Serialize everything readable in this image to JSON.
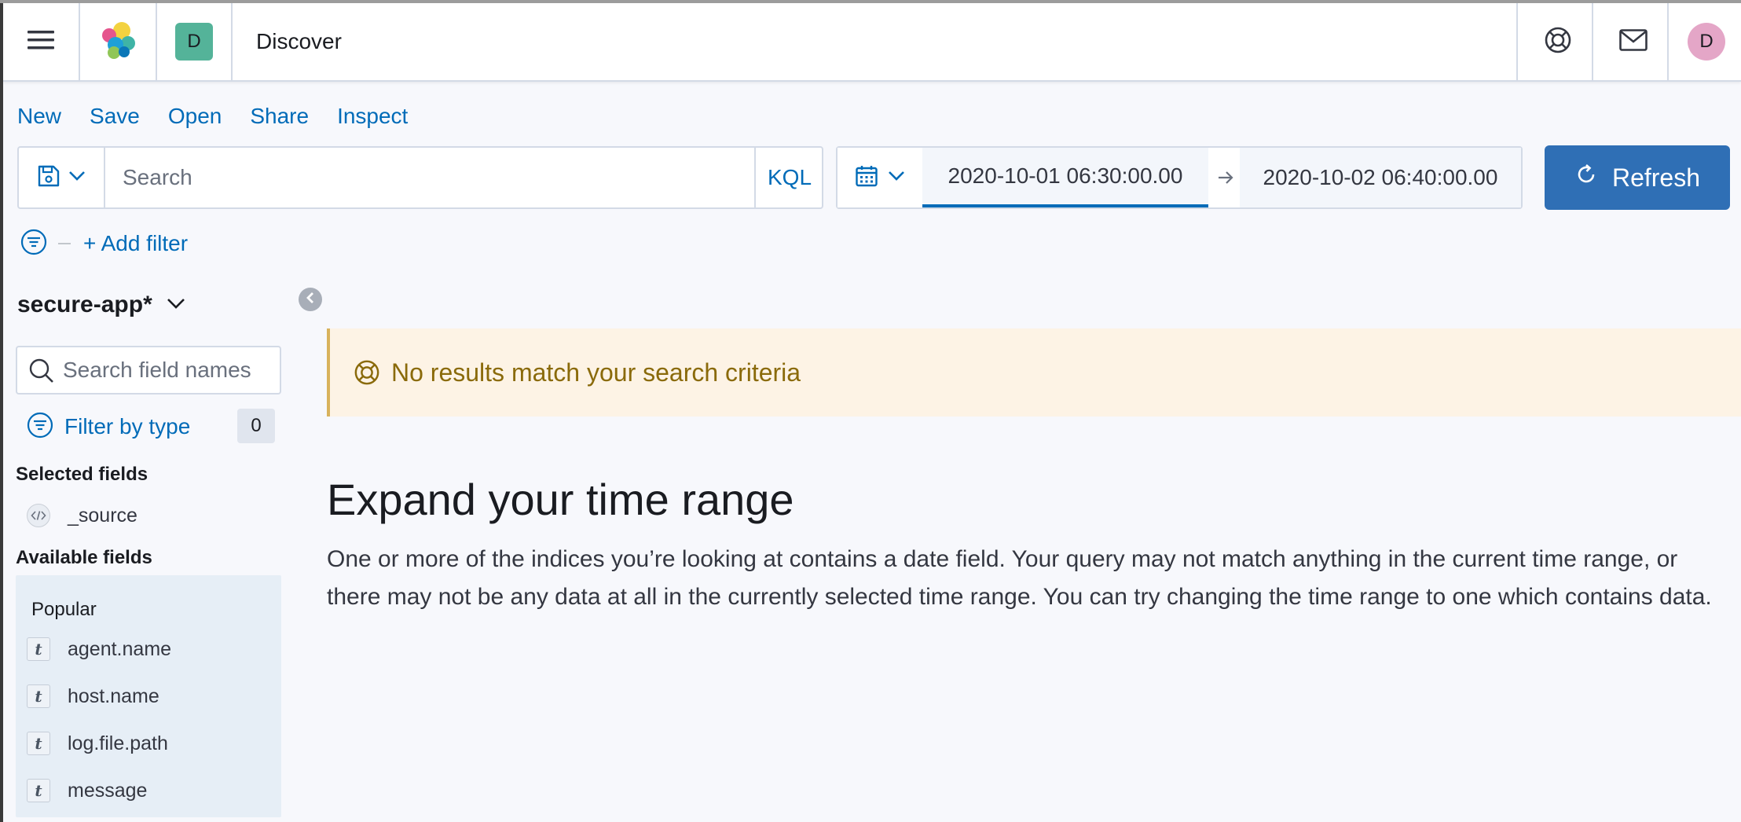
{
  "header": {
    "space_initial": "D",
    "page_title": "Discover",
    "user_initial": "D"
  },
  "topnav": {
    "items": [
      "New",
      "Save",
      "Open",
      "Share",
      "Inspect"
    ]
  },
  "query_bar": {
    "placeholder": "Search",
    "language": "KQL"
  },
  "date_picker": {
    "start": "2020-10-01 06:30:00.00",
    "end": "2020-10-02 06:40:00.00"
  },
  "refresh_label": "Refresh",
  "add_filter_label": "+ Add filter",
  "sidebar": {
    "index_pattern": "secure-app*",
    "field_search_placeholder": "Search field names",
    "filter_by_type_label": "Filter by type",
    "filter_count": "0",
    "selected_title": "Selected fields",
    "selected_fields": [
      "_source"
    ],
    "available_title": "Available fields",
    "popular_title": "Popular",
    "popular_fields": [
      "agent.name",
      "host.name",
      "log.file.path",
      "message"
    ],
    "string_token_glyph": "t"
  },
  "main": {
    "callout_text": "No results match your search criteria",
    "expand_title": "Expand your time range",
    "expand_body": "One or more of the indices you’re looking at contains a date field. Your query may not match anything in the current time range, or there may not be any data at all in the currently selected time range. You can try changing the time range to one which contains data."
  },
  "colors": {
    "link": "#006bb8",
    "primary_button": "#2f6fb5",
    "warning_bg": "#fdf3e5",
    "warning_text": "#8a6a0a",
    "space_avatar": "#54b399",
    "user_avatar": "#e4a6c7"
  }
}
